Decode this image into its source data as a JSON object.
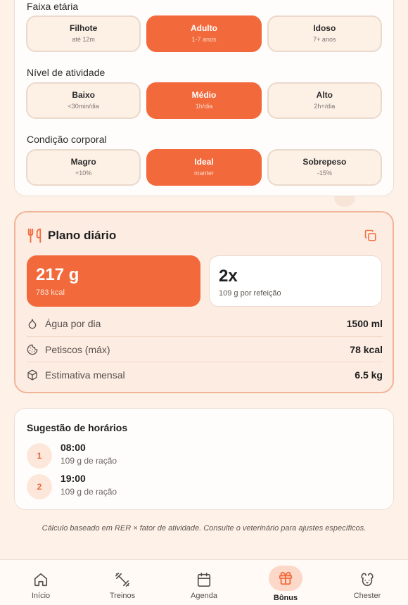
{
  "colors": {
    "accent": "#f26a3c",
    "background": "#fdf1e8",
    "card": "#fffdfb",
    "plan_card": "#fdece2"
  },
  "age": {
    "label": "Faixa etária",
    "options": [
      {
        "title": "Filhote",
        "sub": "até 12m",
        "selected": false
      },
      {
        "title": "Adulto",
        "sub": "1-7 anos",
        "selected": true
      },
      {
        "title": "Idoso",
        "sub": "7+ anos",
        "selected": false
      }
    ]
  },
  "activity": {
    "label": "Nível de atividade",
    "options": [
      {
        "title": "Baixo",
        "sub": "<30min/dia",
        "selected": false
      },
      {
        "title": "Médio",
        "sub": "1h/dia",
        "selected": true
      },
      {
        "title": "Alto",
        "sub": "2h+/dia",
        "selected": false
      }
    ]
  },
  "body": {
    "label": "Condição corporal",
    "options": [
      {
        "title": "Magro",
        "sub": "+10%",
        "selected": false
      },
      {
        "title": "Ideal",
        "sub": "manter",
        "selected": true
      },
      {
        "title": "Sobrepeso",
        "sub": "-15%",
        "selected": false
      }
    ]
  },
  "plan": {
    "title": "Plano diário",
    "icon": "utensils-icon",
    "copy_icon": "copy-icon",
    "daily_amount": "217 g",
    "daily_kcal": "783 kcal",
    "meals": "2x",
    "per_meal": "109 g por refeição",
    "rows": [
      {
        "icon": "droplet-icon",
        "label": "Água por dia",
        "value": "1500 ml"
      },
      {
        "icon": "cookie-icon",
        "label": "Petiscos (máx)",
        "value": "78 kcal"
      },
      {
        "icon": "box-icon",
        "label": "Estimativa mensal",
        "value": "6.5 kg"
      }
    ]
  },
  "schedule": {
    "title": "Sugestão de horários",
    "items": [
      {
        "num": "1",
        "time": "08:00",
        "sub": "109 g de ração"
      },
      {
        "num": "2",
        "time": "19:00",
        "sub": "109 g de ração"
      }
    ]
  },
  "footnote": "Cálculo baseado em RER × fator de atividade. Consulte o veterinário para ajustes específicos.",
  "nav": [
    {
      "label": "Início",
      "icon": "home-icon",
      "active": false
    },
    {
      "label": "Treinos",
      "icon": "dumbbell-icon",
      "active": false
    },
    {
      "label": "Agenda",
      "icon": "calendar-icon",
      "active": false
    },
    {
      "label": "Bônus",
      "icon": "gift-icon",
      "active": true
    },
    {
      "label": "Chester",
      "icon": "dog-icon",
      "active": false
    }
  ]
}
